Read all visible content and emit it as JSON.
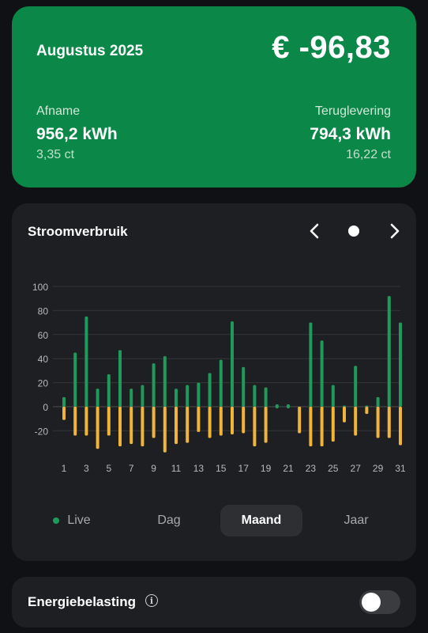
{
  "summary": {
    "month": "Augustus 2025",
    "amount": "€ -96,83",
    "afname_label": "Afname",
    "afname_value": "956,2 kWh",
    "afname_price": "3,35 ct",
    "terug_label": "Teruglevering",
    "terug_value": "794,3 kWh",
    "terug_price": "16,22 ct"
  },
  "card": {
    "title": "Stroomverbruik"
  },
  "segments": {
    "live": "Live",
    "dag": "Dag",
    "maand": "Maand",
    "jaar": "Jaar",
    "active": "Maand"
  },
  "tax": {
    "label": "Energiebelasting",
    "info_icon": "i",
    "toggle_on": false
  },
  "colors": {
    "consumption": "#1f9a5a",
    "return": "#f0b43a",
    "accent": "#0b8748"
  },
  "chart_data": {
    "type": "bar",
    "categories": [
      "1",
      "2",
      "3",
      "4",
      "5",
      "6",
      "7",
      "8",
      "9",
      "10",
      "11",
      "12",
      "13",
      "14",
      "15",
      "16",
      "17",
      "18",
      "19",
      "20",
      "21",
      "22",
      "23",
      "24",
      "25",
      "26",
      "27",
      "28",
      "29",
      "30",
      "31"
    ],
    "x_tick_labels": [
      "1",
      "3",
      "5",
      "7",
      "9",
      "11",
      "13",
      "15",
      "17",
      "19",
      "21",
      "23",
      "25",
      "27",
      "29",
      "31"
    ],
    "series": [
      {
        "values": [
          8,
          45,
          75,
          15,
          27,
          47,
          15,
          18,
          36,
          42,
          15,
          18,
          20,
          28,
          39,
          71,
          33,
          18,
          16,
          2,
          2,
          0,
          70,
          55,
          18,
          1,
          34,
          1,
          8,
          92,
          70
        ]
      },
      {
        "values": [
          -11,
          -24,
          -24,
          -35,
          -24,
          -33,
          -31,
          -33,
          -26,
          -38,
          -31,
          -30,
          -21,
          -26,
          -24,
          -23,
          -22,
          -33,
          -30,
          0,
          0,
          -22,
          -33,
          -33,
          -29,
          -13,
          -24,
          -6,
          -26,
          -26,
          -32
        ]
      }
    ],
    "y_ticks": [
      100,
      80,
      60,
      40,
      20,
      0,
      -20
    ],
    "ylim": [
      -35,
      100
    ],
    "grid": true
  }
}
